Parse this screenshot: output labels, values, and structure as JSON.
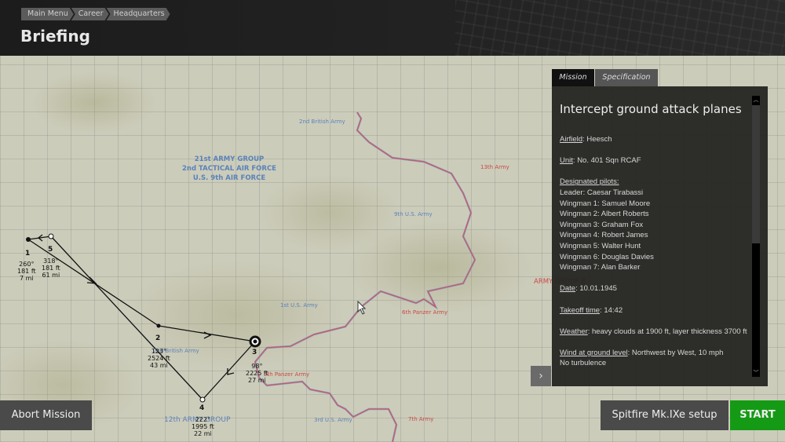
{
  "header": {
    "breadcrumb": [
      "Main Menu",
      "Career",
      "Headquarters"
    ],
    "title": "Briefing"
  },
  "map": {
    "labels": [
      {
        "text": "21st ARMY GROUP\n2nd TACTICAL AIR FORCE\nU.S. 9th AIR FORCE",
        "color": "blue"
      },
      {
        "text": "2nd British Army",
        "color": "blue"
      },
      {
        "text": "9th U.S. Army",
        "color": "blue"
      },
      {
        "text": "1st U.S. Army",
        "color": "blue"
      },
      {
        "text": "2nd British Army",
        "color": "blue"
      },
      {
        "text": "12th ARMY GROUP",
        "color": "blue"
      },
      {
        "text": "3rd U.S. Army",
        "color": "blue"
      },
      {
        "text": "13th Army",
        "color": "red"
      },
      {
        "text": "ARMY GROUP B",
        "color": "red"
      },
      {
        "text": "6th Panzer Army",
        "color": "red"
      },
      {
        "text": "5th Panzer Army",
        "color": "red"
      },
      {
        "text": "7th Army",
        "color": "red"
      }
    ],
    "waypoints": [
      {
        "num": "1",
        "heading": "260°",
        "alt": "181 ft",
        "dist": "7 mi"
      },
      {
        "num": "2",
        "heading": "123°",
        "alt": "2524 ft",
        "dist": "43 mi"
      },
      {
        "num": "3",
        "heading": "98°",
        "alt": "2225 ft",
        "dist": "27 mi"
      },
      {
        "num": "4",
        "heading": "222°",
        "alt": "1995 ft",
        "dist": "22 mi"
      },
      {
        "num": "5",
        "heading": "318°",
        "alt": "181 ft",
        "dist": "61 mi"
      }
    ]
  },
  "panel": {
    "tabs": [
      {
        "label": "Mission",
        "active": true
      },
      {
        "label": "Specification",
        "active": false
      }
    ],
    "title": "Intercept ground attack planes",
    "airfield_label": "Airfield",
    "airfield": "Heesch",
    "unit_label": "Unit",
    "unit": "No. 401 Sqn RCAF",
    "pilots_label": "Designated pilots:",
    "pilots": [
      "Leader: Caesar Tirabassi",
      "Wingman 1: Samuel Moore",
      "Wingman 2: Albert Roberts",
      "Wingman 3: Graham Fox",
      "Wingman 4: Robert James",
      "Wingman 5: Walter Hunt",
      "Wingman 6: Douglas Davies",
      "Wingman 7: Alan Barker"
    ],
    "date_label": "Date",
    "date": "10.01.1945",
    "takeoff_label": "Takeoff time",
    "takeoff": "14:42",
    "weather_label": "Weather",
    "weather": "heavy clouds at 1900 ft, layer thickness 3700 ft",
    "wind_label": "Wind at ground level",
    "wind": "Northwest by West, 10 mph",
    "turbulence": "No turbulence"
  },
  "buttons": {
    "abort": "Abort Mission",
    "setup": "Spitfire Mk.IXe setup",
    "start": "START"
  },
  "colors": {
    "start": "#159a15",
    "route": "#111111",
    "front_line": "#d9534f"
  }
}
